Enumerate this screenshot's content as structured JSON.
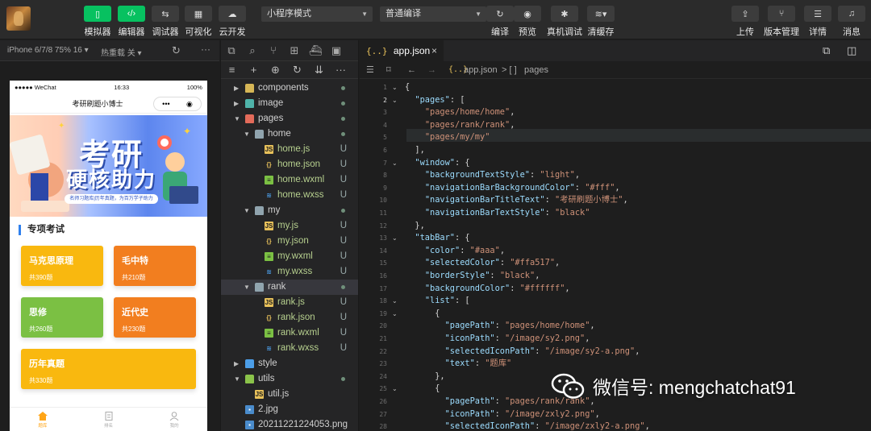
{
  "toolbar": {
    "left": [
      {
        "label": "模拟器",
        "icon": "phone-icon"
      },
      {
        "label": "编辑器",
        "icon": "code-icon"
      },
      {
        "label": "调试器",
        "icon": "sliders-icon"
      },
      {
        "label": "可视化",
        "icon": "layout-icon"
      },
      {
        "label": "云开发",
        "icon": "cloud-icon"
      }
    ],
    "mode_select": "小程序模式",
    "compile_select": "普通编译",
    "center": [
      {
        "label": "编译",
        "icon": "refresh-icon"
      },
      {
        "label": "预览",
        "icon": "eye-icon"
      },
      {
        "label": "真机调试",
        "icon": "bug-icon"
      },
      {
        "label": "清缓存",
        "icon": "layers-icon"
      }
    ],
    "right": [
      {
        "label": "上传",
        "icon": "upload-icon"
      },
      {
        "label": "版本管理",
        "icon": "branch-icon"
      },
      {
        "label": "详情",
        "icon": "menu-icon"
      },
      {
        "label": "消息",
        "icon": "bell-icon"
      }
    ]
  },
  "simulator": {
    "device": "iPhone 6/7/8 75% 16 ▾",
    "hot_reload": "热重载 关 ▾",
    "status_left": "●●●●● WeChat",
    "status_time": "16:33",
    "status_battery": "100%",
    "nav_title": "考研刷题小博士",
    "banner": {
      "line1": "考研",
      "line2": "硬核助力",
      "slogan": "名师习题库|历年真题，为百万学子助力"
    },
    "section_title": "专项考试",
    "cards": [
      {
        "title": "马克思原理",
        "count": "共390题",
        "color": "#f9b80f"
      },
      {
        "title": "毛中特",
        "count": "共210题",
        "color": "#f27e1f"
      },
      {
        "title": "思修",
        "count": "共260题",
        "color": "#7bc043"
      },
      {
        "title": "近代史",
        "count": "共230题",
        "color": "#f27e1f"
      },
      {
        "title": "历年真题",
        "count": "共330题",
        "color": "#f9b80f"
      }
    ],
    "tabbar": [
      {
        "label": "题库",
        "icon": "home-icon",
        "active": true
      },
      {
        "label": "排名",
        "icon": "document-icon",
        "active": false
      },
      {
        "label": "我的",
        "icon": "user-icon",
        "active": false
      }
    ]
  },
  "explorer": {
    "tree": [
      {
        "name": "components",
        "type": "folder",
        "depth": 0,
        "open": false,
        "status": "dot"
      },
      {
        "name": "image",
        "type": "folder",
        "depth": 0,
        "open": false,
        "status": "dot"
      },
      {
        "name": "pages",
        "type": "folder",
        "depth": 0,
        "open": true,
        "status": "dot"
      },
      {
        "name": "home",
        "type": "folder",
        "depth": 1,
        "open": true,
        "status": "dot"
      },
      {
        "name": "home.js",
        "type": "js",
        "depth": 2,
        "status": "U"
      },
      {
        "name": "home.json",
        "type": "json",
        "depth": 2,
        "status": "U"
      },
      {
        "name": "home.wxml",
        "type": "wxml",
        "depth": 2,
        "status": "U"
      },
      {
        "name": "home.wxss",
        "type": "wxss",
        "depth": 2,
        "status": "U"
      },
      {
        "name": "my",
        "type": "folder",
        "depth": 1,
        "open": true,
        "status": "dot"
      },
      {
        "name": "my.js",
        "type": "js",
        "depth": 2,
        "status": "U"
      },
      {
        "name": "my.json",
        "type": "json",
        "depth": 2,
        "status": "U"
      },
      {
        "name": "my.wxml",
        "type": "wxml",
        "depth": 2,
        "status": "U"
      },
      {
        "name": "my.wxss",
        "type": "wxss",
        "depth": 2,
        "status": "U"
      },
      {
        "name": "rank",
        "type": "folder",
        "depth": 1,
        "open": true,
        "status": "dot",
        "selected": true
      },
      {
        "name": "rank.js",
        "type": "js",
        "depth": 2,
        "status": "U"
      },
      {
        "name": "rank.json",
        "type": "json",
        "depth": 2,
        "status": "U"
      },
      {
        "name": "rank.wxml",
        "type": "wxml",
        "depth": 2,
        "status": "U"
      },
      {
        "name": "rank.wxss",
        "type": "wxss",
        "depth": 2,
        "status": "U"
      },
      {
        "name": "style",
        "type": "folder",
        "depth": 0,
        "open": false,
        "status": ""
      },
      {
        "name": "utils",
        "type": "folder",
        "depth": 0,
        "open": true,
        "status": "dot"
      },
      {
        "name": "util.js",
        "type": "js",
        "depth": 1,
        "status": ""
      },
      {
        "name": "2.jpg",
        "type": "img",
        "depth": 0,
        "status": ""
      },
      {
        "name": "20211221224053.png",
        "type": "img",
        "depth": 0,
        "status": ""
      }
    ]
  },
  "editor": {
    "tab": "app.json",
    "tab_close": "×",
    "breadcrumb_file": "app.json",
    "breadcrumb_sep": "> [ ]",
    "breadcrumb_key": "pages",
    "lines": [
      {
        "n": "1",
        "t": "{"
      },
      {
        "n": "2",
        "t": "  \"pages\": ["
      },
      {
        "n": "3",
        "t": "    \"pages/home/home\","
      },
      {
        "n": "4",
        "t": "    \"pages/rank/rank\","
      },
      {
        "n": "5",
        "t": "    \"pages/my/my\""
      },
      {
        "n": "6",
        "t": "  ],"
      },
      {
        "n": "7",
        "t": "  \"window\": {"
      },
      {
        "n": "8",
        "t": "    \"backgroundTextStyle\": \"light\","
      },
      {
        "n": "9",
        "t": "    \"navigationBarBackgroundColor\": \"#fff\","
      },
      {
        "n": "10",
        "t": "    \"navigationBarTitleText\": \"考研刷题小博士\","
      },
      {
        "n": "11",
        "t": "    \"navigationBarTextStyle\": \"black\""
      },
      {
        "n": "12",
        "t": "  },"
      },
      {
        "n": "13",
        "t": "  \"tabBar\": {"
      },
      {
        "n": "14",
        "t": "    \"color\": \"#aaa\","
      },
      {
        "n": "15",
        "t": "    \"selectedColor\": \"#ffa517\","
      },
      {
        "n": "16",
        "t": "    \"borderStyle\": \"black\","
      },
      {
        "n": "17",
        "t": "    \"backgroundColor\": \"#ffffff\","
      },
      {
        "n": "18",
        "t": "    \"list\": ["
      },
      {
        "n": "19",
        "t": "      {"
      },
      {
        "n": "20",
        "t": "        \"pagePath\": \"pages/home/home\","
      },
      {
        "n": "21",
        "t": "        \"iconPath\": \"/image/sy2.png\","
      },
      {
        "n": "22",
        "t": "        \"selectedIconPath\": \"/image/sy2-a.png\","
      },
      {
        "n": "23",
        "t": "        \"text\": \"题库\""
      },
      {
        "n": "24",
        "t": "      },"
      },
      {
        "n": "25",
        "t": "      {"
      },
      {
        "n": "26",
        "t": "        \"pagePath\": \"pages/rank/rank\","
      },
      {
        "n": "27",
        "t": "        \"iconPath\": \"/image/zxly2.png\","
      },
      {
        "n": "28",
        "t": "        \"selectedIconPath\": \"/image/zxly2-a.png\","
      }
    ]
  },
  "watermark": "微信号: mengchatchat91",
  "colors": {
    "accent": "#07c160",
    "tab_active": "#ffa517"
  }
}
